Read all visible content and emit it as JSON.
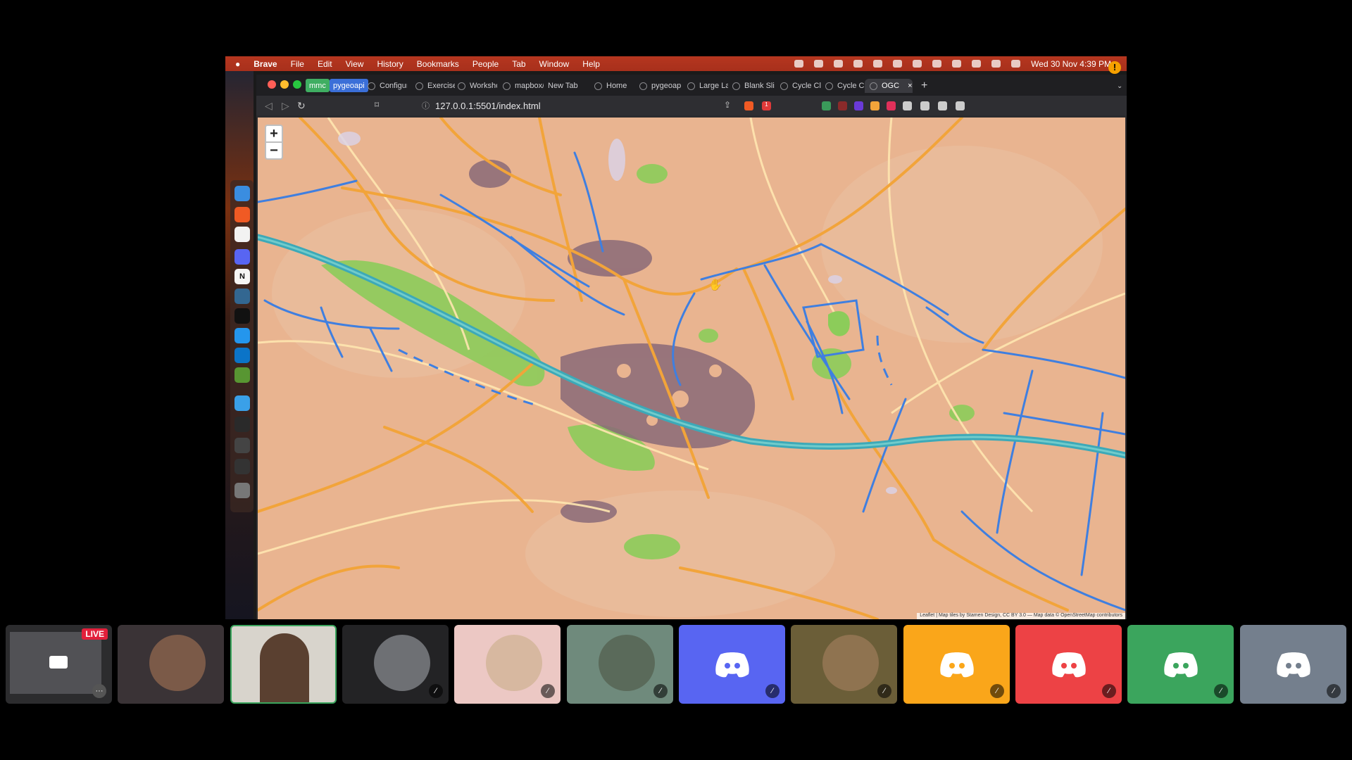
{
  "menubar": {
    "app": "Brave",
    "items": [
      "File",
      "Edit",
      "View",
      "History",
      "Bookmarks",
      "People",
      "Tab",
      "Window",
      "Help"
    ],
    "clock": "Wed 30 Nov  4:39 PM"
  },
  "tabs": {
    "groups": [
      "mmc",
      "pygeoapi"
    ],
    "items": [
      "Configur",
      "Exercise",
      "Worksho",
      "mapbox/",
      "New Tab",
      "Home",
      "pygeoap",
      "Large La",
      "Blank Sli",
      "Cycle Cli",
      "Cycle Cli"
    ],
    "active": "OGC",
    "new_tab": "+"
  },
  "address": {
    "url": "127.0.0.1:5501/index.html",
    "shields_badge": "1"
  },
  "map": {
    "zoom_in": "+",
    "zoom_out": "−",
    "attribution": "Leaflet | Map tiles by Stamen Design, CC BY 3.0 — Map data © OpenStreetMap contributors",
    "colors": {
      "land": "#e9b490",
      "roads_major": "#f2a43a",
      "roads_minor": "#ffe6b0",
      "cycle": "#3f7fe0",
      "river": "#3ca9b8",
      "park": "#8ccc5a",
      "buildings": "#8a6a78"
    }
  },
  "call": {
    "live_badge": "LIVE",
    "tiles": [
      {
        "kind": "screen",
        "color": "#2c2c2e"
      },
      {
        "kind": "avatar",
        "color": "#3a3336",
        "face": "#7b5a48"
      },
      {
        "kind": "video",
        "color": "#d8d4cc",
        "face": "#5a4030"
      },
      {
        "kind": "avatar",
        "color": "#232325",
        "face": "#6e7074"
      },
      {
        "kind": "avatar",
        "color": "#ecc8c4",
        "face": "#d7b8a0"
      },
      {
        "kind": "avatar",
        "color": "#6f8a7c",
        "face": "#5a6a5a"
      },
      {
        "kind": "discord",
        "color": "#5865f2"
      },
      {
        "kind": "avatar",
        "color": "#6b5e38",
        "face": "#8f7350"
      },
      {
        "kind": "discord",
        "color": "#faa61a"
      },
      {
        "kind": "discord",
        "color": "#ed4245"
      },
      {
        "kind": "discord",
        "color": "#3ba55d"
      },
      {
        "kind": "discord",
        "color": "#747f8d"
      }
    ]
  }
}
